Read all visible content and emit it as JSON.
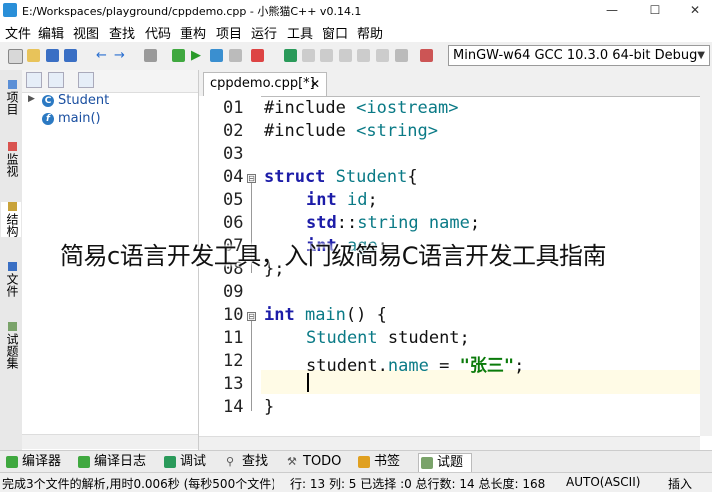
{
  "window": {
    "title": "E:/Workspaces/playground/cppdemo.cpp - 小熊猫C++ v0.14.1",
    "minimize": "—",
    "maximize": "☐",
    "close": "✕"
  },
  "menu": [
    "文件",
    "编辑",
    "视图",
    "查找",
    "代码",
    "重构",
    "项目",
    "运行",
    "工具",
    "窗口",
    "帮助"
  ],
  "compiler": {
    "selected": "MinGW-w64 GCC 10.3.0 64-bit Debug"
  },
  "left_tabs": [
    "项目",
    "监视",
    "结构",
    "文件",
    "试题集"
  ],
  "class_tree": [
    {
      "label": "Student",
      "icon": "C"
    },
    {
      "label": "main()",
      "icon": "f"
    }
  ],
  "editor": {
    "tab_label": "cppdemo.cpp[*]",
    "tab_close": "✕",
    "line_numbers": [
      "01",
      "02",
      "03",
      "04",
      "05",
      "06",
      "07",
      "08",
      "09",
      "10",
      "11",
      "12",
      "13",
      "14"
    ],
    "fold_markers": [
      "⊟",
      "⊟"
    ],
    "lines": {
      "l1": [
        "#include",
        " <iostream>"
      ],
      "l2": [
        "#include",
        " <string>"
      ],
      "l4": [
        "struct",
        " Student",
        "{"
      ],
      "l5": [
        "int",
        " id",
        ";"
      ],
      "l6": [
        "std",
        "::",
        "string",
        " name",
        ";"
      ],
      "l7": [
        "int",
        " age",
        ";"
      ],
      "l8": [
        "}",
        ";"
      ],
      "l10": [
        "int",
        " main",
        "() {"
      ],
      "l11": [
        "Student",
        " student",
        ";"
      ],
      "l12": [
        "student",
        ".",
        "name",
        " = ",
        "\"张三\"",
        ";"
      ],
      "l14": [
        "}"
      ]
    }
  },
  "overlay_caption": "简易c语言开发工具，入门级简易C语言开发工具指南",
  "bottom_tabs": [
    "编译器",
    "编译日志",
    "调试",
    "查找",
    "TODO",
    "书签",
    "试题"
  ],
  "status": {
    "message": "完成3个文件的解析,用时0.006秒 (每秒500个文件)",
    "position": "行: 13 列: 5 已选择 :0 总行数: 14 总长度: 168",
    "encoding": "AUTO(ASCII)",
    "mode": "插入"
  }
}
